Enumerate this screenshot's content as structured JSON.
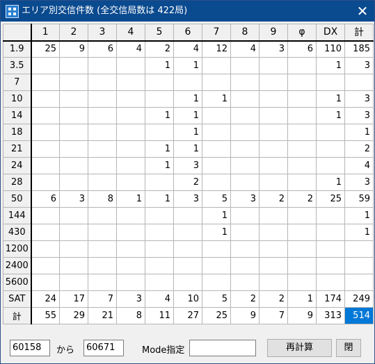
{
  "window": {
    "title": "エリア別交信件数 (全交信局数は 422局)",
    "close_glyph": "✕"
  },
  "table": {
    "columns": [
      "1",
      "2",
      "3",
      "4",
      "5",
      "6",
      "7",
      "8",
      "9",
      "φ",
      "DX",
      "計"
    ],
    "rows": [
      {
        "band": "1.9",
        "cells": [
          "25",
          "9",
          "6",
          "4",
          "2",
          "4",
          "12",
          "4",
          "3",
          "6",
          "110",
          "185"
        ]
      },
      {
        "band": "3.5",
        "cells": [
          "",
          "",
          "",
          "",
          "1",
          "1",
          "",
          "",
          "",
          "",
          "1",
          "3"
        ]
      },
      {
        "band": "7",
        "cells": [
          "",
          "",
          "",
          "",
          "",
          "",
          "",
          "",
          "",
          "",
          "",
          ""
        ]
      },
      {
        "band": "10",
        "cells": [
          "",
          "",
          "",
          "",
          "",
          "1",
          "1",
          "",
          "",
          "",
          "1",
          "3"
        ]
      },
      {
        "band": "14",
        "cells": [
          "",
          "",
          "",
          "",
          "1",
          "1",
          "",
          "",
          "",
          "",
          "1",
          "3"
        ]
      },
      {
        "band": "18",
        "cells": [
          "",
          "",
          "",
          "",
          "",
          "1",
          "",
          "",
          "",
          "",
          "",
          "1"
        ]
      },
      {
        "band": "21",
        "cells": [
          "",
          "",
          "",
          "",
          "1",
          "1",
          "",
          "",
          "",
          "",
          "",
          "2"
        ]
      },
      {
        "band": "24",
        "cells": [
          "",
          "",
          "",
          "",
          "1",
          "3",
          "",
          "",
          "",
          "",
          "",
          "4"
        ]
      },
      {
        "band": "28",
        "cells": [
          "",
          "",
          "",
          "",
          "",
          "2",
          "",
          "",
          "",
          "",
          "1",
          "3"
        ]
      },
      {
        "band": "50",
        "cells": [
          "6",
          "3",
          "8",
          "1",
          "1",
          "3",
          "5",
          "3",
          "2",
          "2",
          "25",
          "59"
        ]
      },
      {
        "band": "144",
        "cells": [
          "",
          "",
          "",
          "",
          "",
          "",
          "1",
          "",
          "",
          "",
          "",
          "1"
        ]
      },
      {
        "band": "430",
        "cells": [
          "",
          "",
          "",
          "",
          "",
          "",
          "1",
          "",
          "",
          "",
          "",
          "1"
        ]
      },
      {
        "band": "1200",
        "cells": [
          "",
          "",
          "",
          "",
          "",
          "",
          "",
          "",
          "",
          "",
          "",
          ""
        ]
      },
      {
        "band": "2400",
        "cells": [
          "",
          "",
          "",
          "",
          "",
          "",
          "",
          "",
          "",
          "",
          "",
          ""
        ]
      },
      {
        "band": "5600",
        "cells": [
          "",
          "",
          "",
          "",
          "",
          "",
          "",
          "",
          "",
          "",
          "",
          ""
        ]
      },
      {
        "band": "SAT",
        "cells": [
          "24",
          "17",
          "7",
          "3",
          "4",
          "10",
          "5",
          "2",
          "2",
          "1",
          "174",
          "249"
        ]
      },
      {
        "band": "計",
        "cells": [
          "55",
          "29",
          "21",
          "8",
          "11",
          "27",
          "25",
          "9",
          "7",
          "9",
          "313",
          "514"
        ]
      }
    ],
    "selected_value": "514"
  },
  "footer": {
    "from_value": "60158",
    "from_label": "から",
    "to_value": "60671",
    "mode_label": "Mode指定",
    "mode_value": "",
    "recalc_label": "再計算",
    "close_label": "閉"
  },
  "colors": {
    "titlebar": "#0a4a8f",
    "selection": "#0078d7"
  }
}
